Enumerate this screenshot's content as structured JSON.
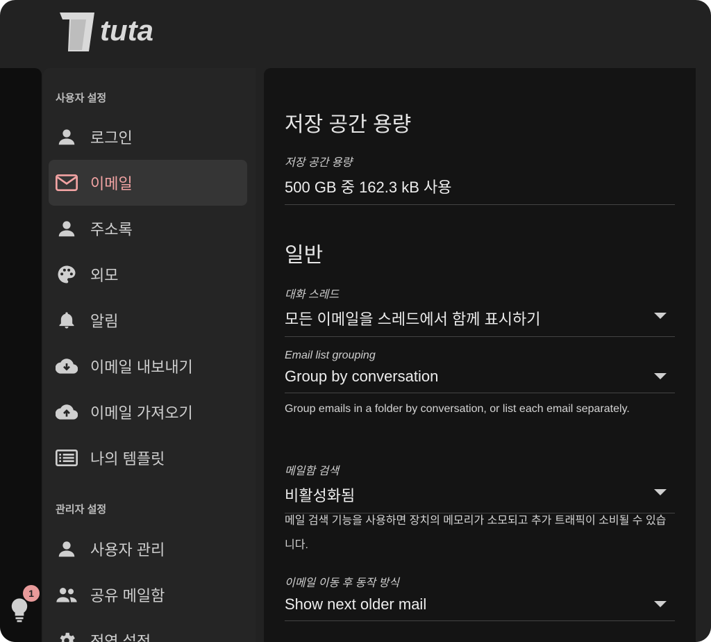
{
  "app": {
    "brand": "tuta"
  },
  "sidebar": {
    "user_section": "사용자 설정",
    "admin_section": "관리자 설정",
    "items": [
      {
        "label": "로그인",
        "icon": "person-icon"
      },
      {
        "label": "이메일",
        "icon": "mail-icon",
        "active": true
      },
      {
        "label": "주소록",
        "icon": "person-icon"
      },
      {
        "label": "외모",
        "icon": "palette-icon"
      },
      {
        "label": "알림",
        "icon": "bell-icon"
      },
      {
        "label": "이메일 내보내기",
        "icon": "cloud-download-icon"
      },
      {
        "label": "이메일 가져오기",
        "icon": "cloud-upload-icon"
      },
      {
        "label": "나의 템플릿",
        "icon": "list-icon"
      }
    ],
    "admin_items": [
      {
        "label": "사용자 관리",
        "icon": "person-icon"
      },
      {
        "label": "공유 메일함",
        "icon": "people-icon"
      },
      {
        "label": "전역 설정",
        "icon": "gear-icon"
      }
    ]
  },
  "hint": {
    "badge_count": "1"
  },
  "content": {
    "storage_heading": "저장 공간 용량",
    "storage_label": "저장 공간 용량",
    "storage_value": "500 GB 중 162.3 kB 사용",
    "general_heading": "일반",
    "thread_label": "대화 스레드",
    "thread_value": "모든 이메일을 스레드에서 함께 표시하기",
    "grouping_label": "Email list grouping",
    "grouping_value": "Group by conversation",
    "grouping_help": "Group emails in a folder by conversation, or list each email separately.",
    "search_label": "메일함 검색",
    "search_value": "비활성화됨",
    "search_help": "메일 검색 기능을 사용하면 장치의 메모리가 소모되고 추가 트래픽이 소비될 수 있습니다.",
    "move_label": "이메일 이동 후 동작 방식",
    "move_value": "Show next older mail"
  },
  "colors": {
    "accent": "#f2a3a3",
    "background": "#222222",
    "content_bg": "#141414"
  }
}
